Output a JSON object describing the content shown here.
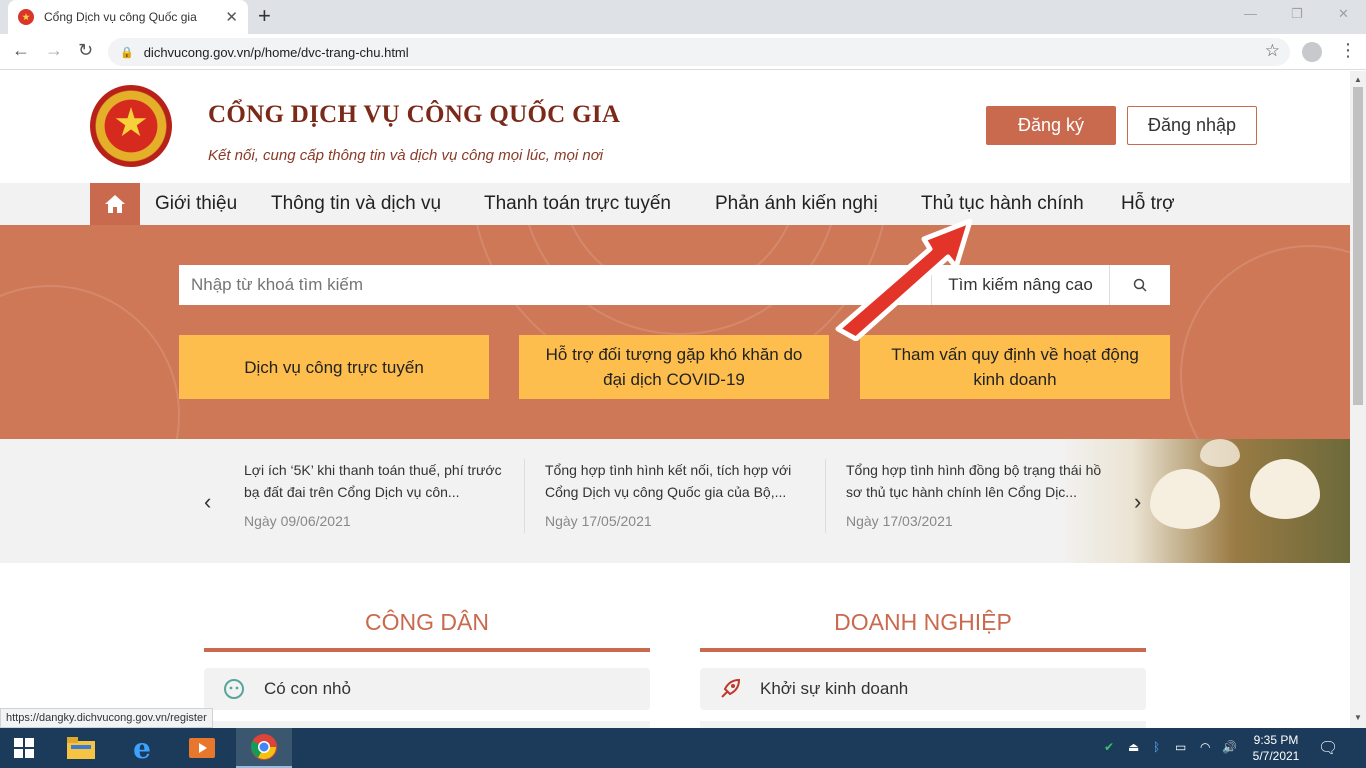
{
  "browser": {
    "tab_title": "Cổng Dịch vụ công Quốc gia",
    "new_tab": "+",
    "url": "dichvucong.gov.vn/p/home/dvc-trang-chu.html",
    "status_url": "https://dangky.dichvucong.gov.vn/register"
  },
  "header": {
    "brand": "CỔNG DỊCH VỤ CÔNG QUỐC GIA",
    "slogan": "Kết nối, cung cấp thông tin và dịch vụ công mọi lúc, mọi nơi",
    "register": "Đăng ký",
    "login": "Đăng nhập"
  },
  "menu": [
    "Giới thiệu",
    "Thông tin và dịch vụ",
    "Thanh toán trực tuyến",
    "Phản ánh kiến nghị",
    "Thủ tục hành chính",
    "Hỗ trợ"
  ],
  "search": {
    "placeholder": "Nhập từ khoá tìm kiếm",
    "advanced": "Tìm kiếm nâng cao"
  },
  "cards": [
    {
      "line1": "Dịch vụ công trực tuyến",
      "line2": ""
    },
    {
      "line1": "Hỗ trợ đối tượng gặp khó khăn do",
      "line2": "đại dịch COVID-19"
    },
    {
      "line1": "Tham vấn quy định về hoạt động",
      "line2": "kinh doanh"
    }
  ],
  "news": [
    {
      "title": "Lợi ích ‘5K’ khi thanh toán thuế, phí trước bạ đất đai trên Cổng Dịch vụ côn...",
      "date": "Ngày 09/06/2021"
    },
    {
      "title": "Tổng hợp tình hình kết nối, tích hợp với Cổng Dịch vụ công Quốc gia của Bộ,...",
      "date": "Ngày 17/05/2021"
    },
    {
      "title": "Tổng hợp tình hình đồng bộ trạng thái hồ sơ thủ tục hành chính lên Cổng Dịc...",
      "date": "Ngày 17/03/2021"
    }
  ],
  "sections": {
    "citizen": {
      "title": "CÔNG DÂN",
      "first_item": "Có con nhỏ"
    },
    "business": {
      "title": "DOANH NGHIỆP",
      "first_item": "Khởi sự kinh doanh"
    }
  },
  "taskbar": {
    "time": "9:35 PM",
    "date": "5/7/2021"
  },
  "colors": {
    "primary": "#c9694e",
    "hero": "#cf7858",
    "card": "#fdbe4d"
  }
}
